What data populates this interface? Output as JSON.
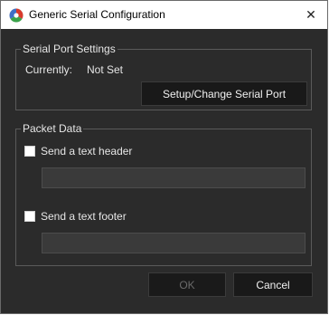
{
  "window": {
    "title": "Generic Serial Configuration",
    "close_glyph": "✕"
  },
  "serial_port_settings": {
    "legend": "Serial Port Settings",
    "currently_label": "Currently:",
    "currently_value": "Not Set",
    "setup_button": "Setup/Change Serial Port"
  },
  "packet_data": {
    "legend": "Packet Data",
    "header": {
      "label": "Send a text header",
      "checked": false,
      "value": ""
    },
    "footer": {
      "label": "Send a text footer",
      "checked": false,
      "value": ""
    }
  },
  "buttons": {
    "ok": "OK",
    "ok_enabled": false,
    "cancel": "Cancel"
  },
  "colors": {
    "background": "#2b2b2b",
    "button_bg": "#191919",
    "text": "#e6e6e6",
    "disabled_text": "#6a6a6a"
  }
}
